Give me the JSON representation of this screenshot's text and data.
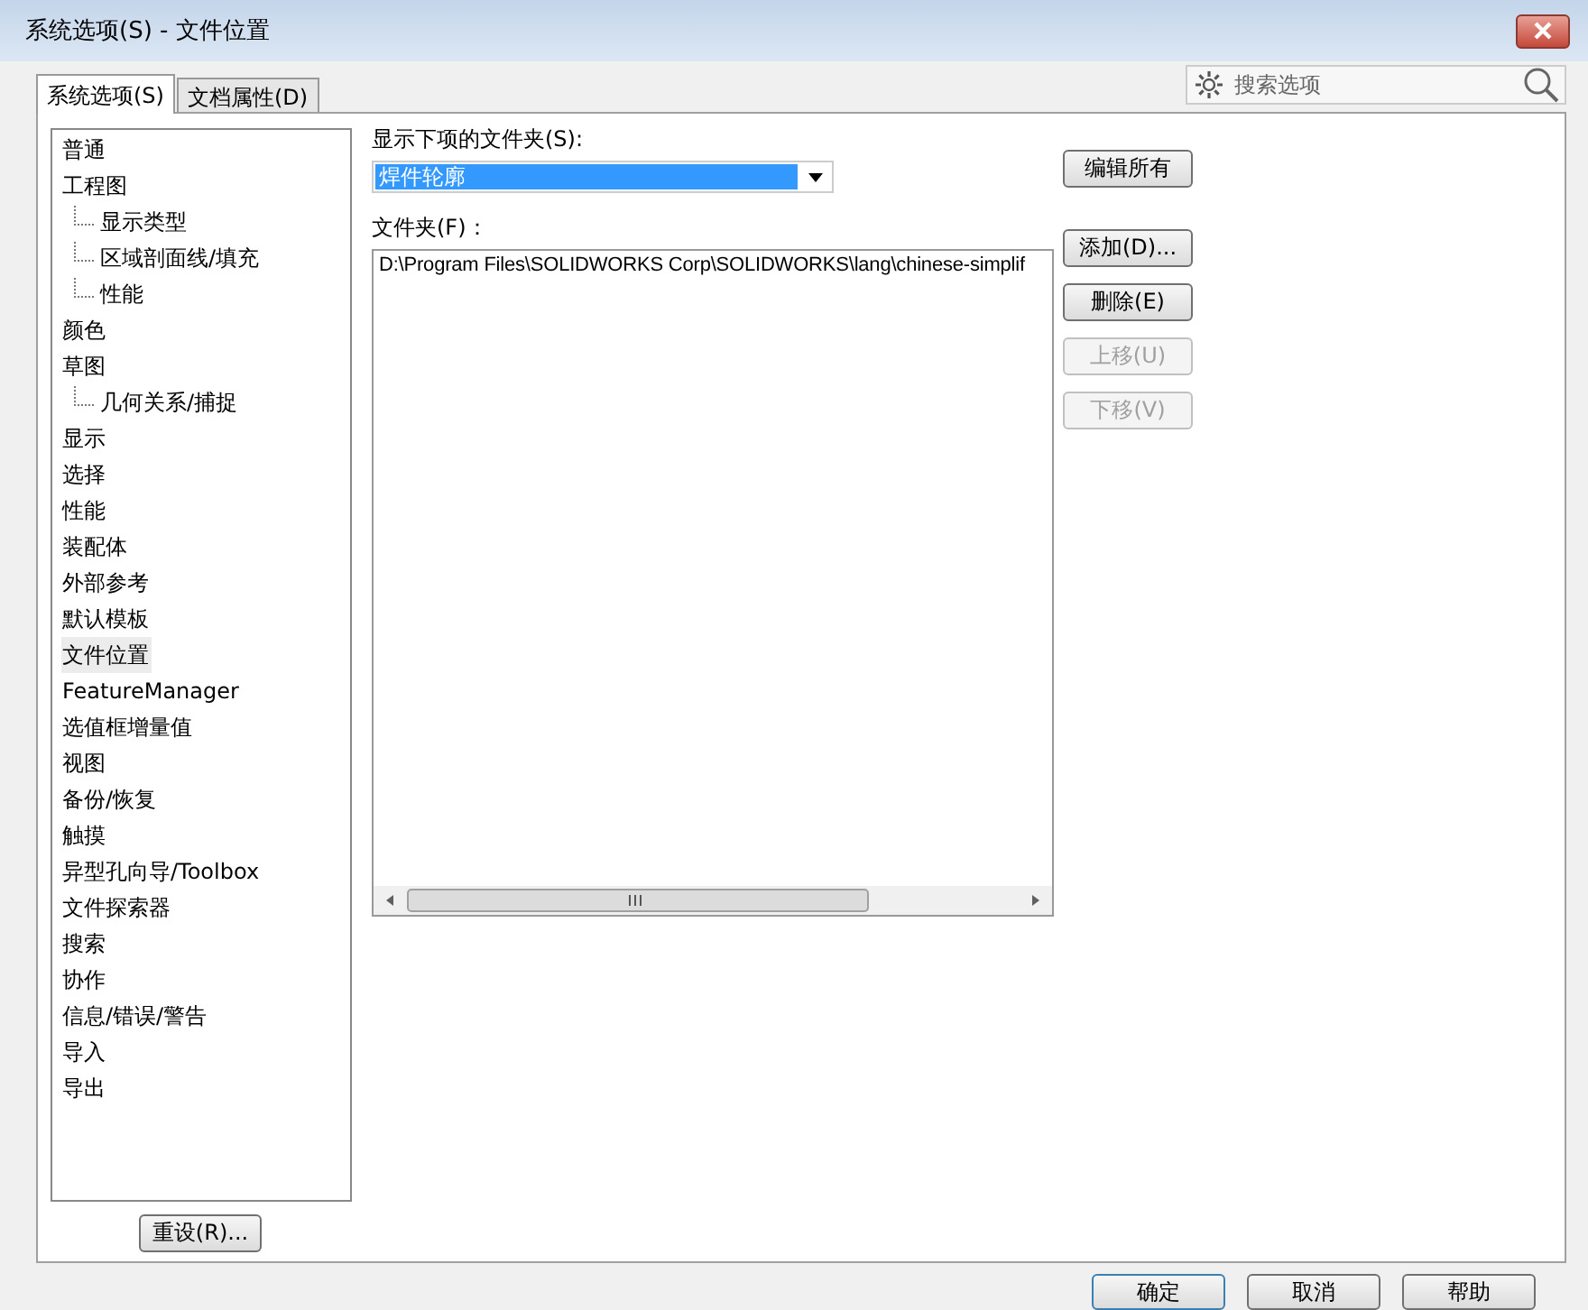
{
  "window": {
    "title": "系统选项(S) - 文件位置"
  },
  "tabs": [
    {
      "label": "系统选项(S)",
      "selected": true
    },
    {
      "label": "文档属性(D)",
      "selected": false
    }
  ],
  "search": {
    "placeholder": "搜索选项"
  },
  "tree": [
    {
      "label": "普通",
      "selected": false
    },
    {
      "label": "工程图",
      "selected": false,
      "children": [
        {
          "label": "显示类型",
          "selected": false
        },
        {
          "label": "区域剖面线/填充",
          "selected": false
        },
        {
          "label": "性能",
          "selected": false
        }
      ]
    },
    {
      "label": "颜色",
      "selected": false
    },
    {
      "label": "草图",
      "selected": false,
      "children": [
        {
          "label": "几何关系/捕捉",
          "selected": false
        }
      ]
    },
    {
      "label": "显示",
      "selected": false
    },
    {
      "label": "选择",
      "selected": false
    },
    {
      "label": "性能",
      "selected": false
    },
    {
      "label": "装配体",
      "selected": false
    },
    {
      "label": "外部参考",
      "selected": false
    },
    {
      "label": "默认模板",
      "selected": false
    },
    {
      "label": "文件位置",
      "selected": true
    },
    {
      "label": "FeatureManager",
      "selected": false
    },
    {
      "label": "选值框增量值",
      "selected": false
    },
    {
      "label": "视图",
      "selected": false
    },
    {
      "label": "备份/恢复",
      "selected": false
    },
    {
      "label": "触摸",
      "selected": false
    },
    {
      "label": "异型孔向导/Toolbox",
      "selected": false
    },
    {
      "label": "文件探索器",
      "selected": false
    },
    {
      "label": "搜索",
      "selected": false
    },
    {
      "label": "协作",
      "selected": false
    },
    {
      "label": "信息/错误/警告",
      "selected": false
    },
    {
      "label": "导入",
      "selected": false
    },
    {
      "label": "导出",
      "selected": false
    }
  ],
  "folder_type": {
    "label": "显示下项的文件夹(S):",
    "value": "焊件轮廓"
  },
  "edit_all_button": "编辑所有",
  "folders": {
    "label": "文件夹(F)：",
    "paths": [
      "D:\\Program Files\\SOLIDWORKS Corp\\SOLIDWORKS\\lang\\chinese-simplif"
    ]
  },
  "folder_buttons": [
    {
      "label": "添加(D)...",
      "disabled": false
    },
    {
      "label": "删除(E)",
      "disabled": false
    },
    {
      "label": "上移(U)",
      "disabled": true
    },
    {
      "label": "下移(V)",
      "disabled": true
    }
  ],
  "reset_button": "重设(R)...",
  "dialog_buttons": [
    "确定",
    "取消",
    "帮助"
  ]
}
